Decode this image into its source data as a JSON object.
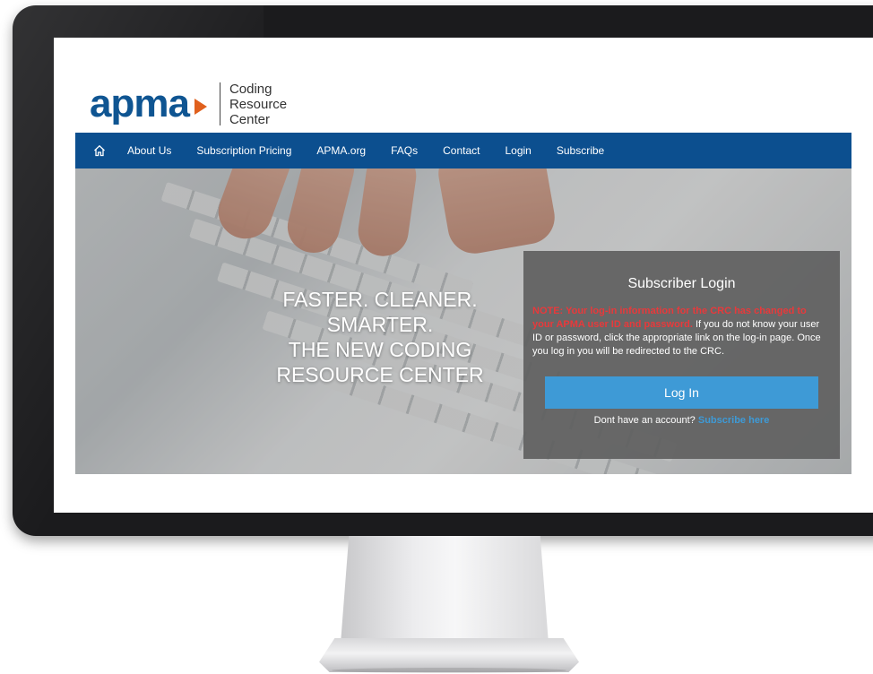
{
  "logo": {
    "wordmark": "apma",
    "subtitle_line1": "Coding",
    "subtitle_line2": "Resource",
    "subtitle_line3": "Center"
  },
  "nav": {
    "home_icon": "home-icon",
    "items": [
      "About Us",
      "Subscription Pricing",
      "APMA.org",
      "FAQs",
      "Contact",
      "Login",
      "Subscribe"
    ]
  },
  "hero": {
    "line1": "FASTER. CLEANER.",
    "line2": "SMARTER.",
    "line3": "THE NEW CODING",
    "line4": "RESOURCE CENTER"
  },
  "login": {
    "title": "Subscriber Login",
    "note": "NOTE: Your log-in information for the CRC has changed to your APMA user ID and password.",
    "body": " If you do not know your user ID or password, click the appropriate link on the log-in page. Once you log in you will be redirected to the CRC.",
    "button": "Log In",
    "footer_text": "Dont have an account?",
    "footer_link": "Subscribe here"
  },
  "colors": {
    "brand_blue": "#0c4f8f",
    "accent_orange": "#e0601d",
    "button_blue": "#3e9ad6",
    "note_red": "#e8393b"
  }
}
